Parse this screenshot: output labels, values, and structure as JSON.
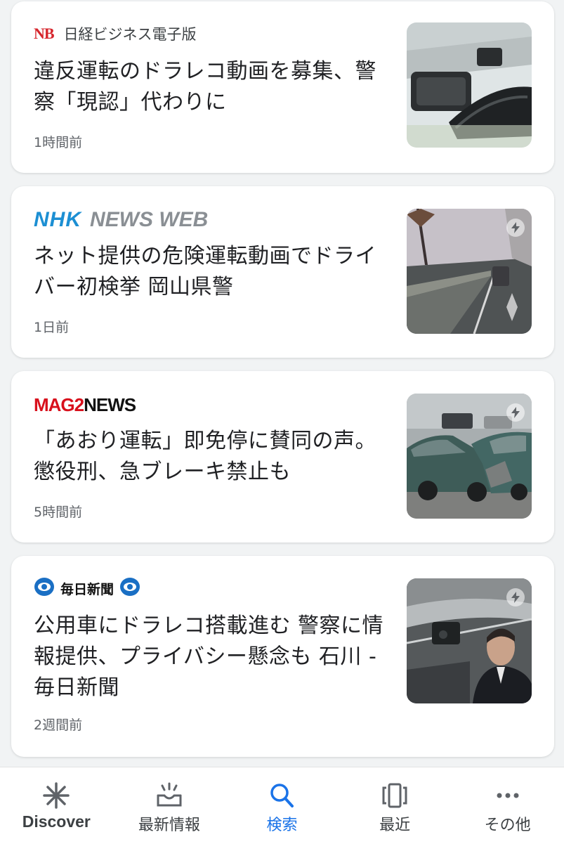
{
  "articles": [
    {
      "source_mark": "NB",
      "source_name": "日経ビジネス電子版",
      "headline": "違反運転のドラレコ動画を募集、警察「現認」代わりに",
      "time": "1時間前",
      "image": "dashcam-mirror-photo",
      "amp": false
    },
    {
      "source_mark": "NHK",
      "source_name": "NEWS WEB",
      "headline": "ネット提供の危険運転動画でドライバー初検挙 岡山県警",
      "time": "1日前",
      "image": "road-dashcam-photo",
      "amp": true
    },
    {
      "source_mark": "MAG2",
      "source_name": "NEWS",
      "headline": "「あおり運転」即免停に賛同の声。懲役刑、急ブレーキ禁止も",
      "time": "5時間前",
      "image": "car-crash-photo",
      "amp": true
    },
    {
      "source_mark": "",
      "source_name": "毎日新聞",
      "headline": "公用車にドラレコ搭載進む 警察に情報提供、プライバシー懸念も 石川 - 毎日新聞",
      "time": "2週間前",
      "image": "official-car-driver-photo",
      "amp": true
    }
  ],
  "bottom_nav": [
    {
      "label": "Discover",
      "icon": "asterisk-icon",
      "active": false
    },
    {
      "label": "最新情報",
      "icon": "inbox-updates-icon",
      "active": false
    },
    {
      "label": "検索",
      "icon": "search-icon",
      "active": true
    },
    {
      "label": "最近",
      "icon": "recent-cards-icon",
      "active": false
    },
    {
      "label": "その他",
      "icon": "more-dots-icon",
      "active": false
    }
  ],
  "colors": {
    "accent": "#1a73e8",
    "nb_red": "#d6252c",
    "nhk_blue": "#1c8fd3",
    "mag_red": "#d8101c",
    "mainichi_blue": "#1a6fc4"
  }
}
